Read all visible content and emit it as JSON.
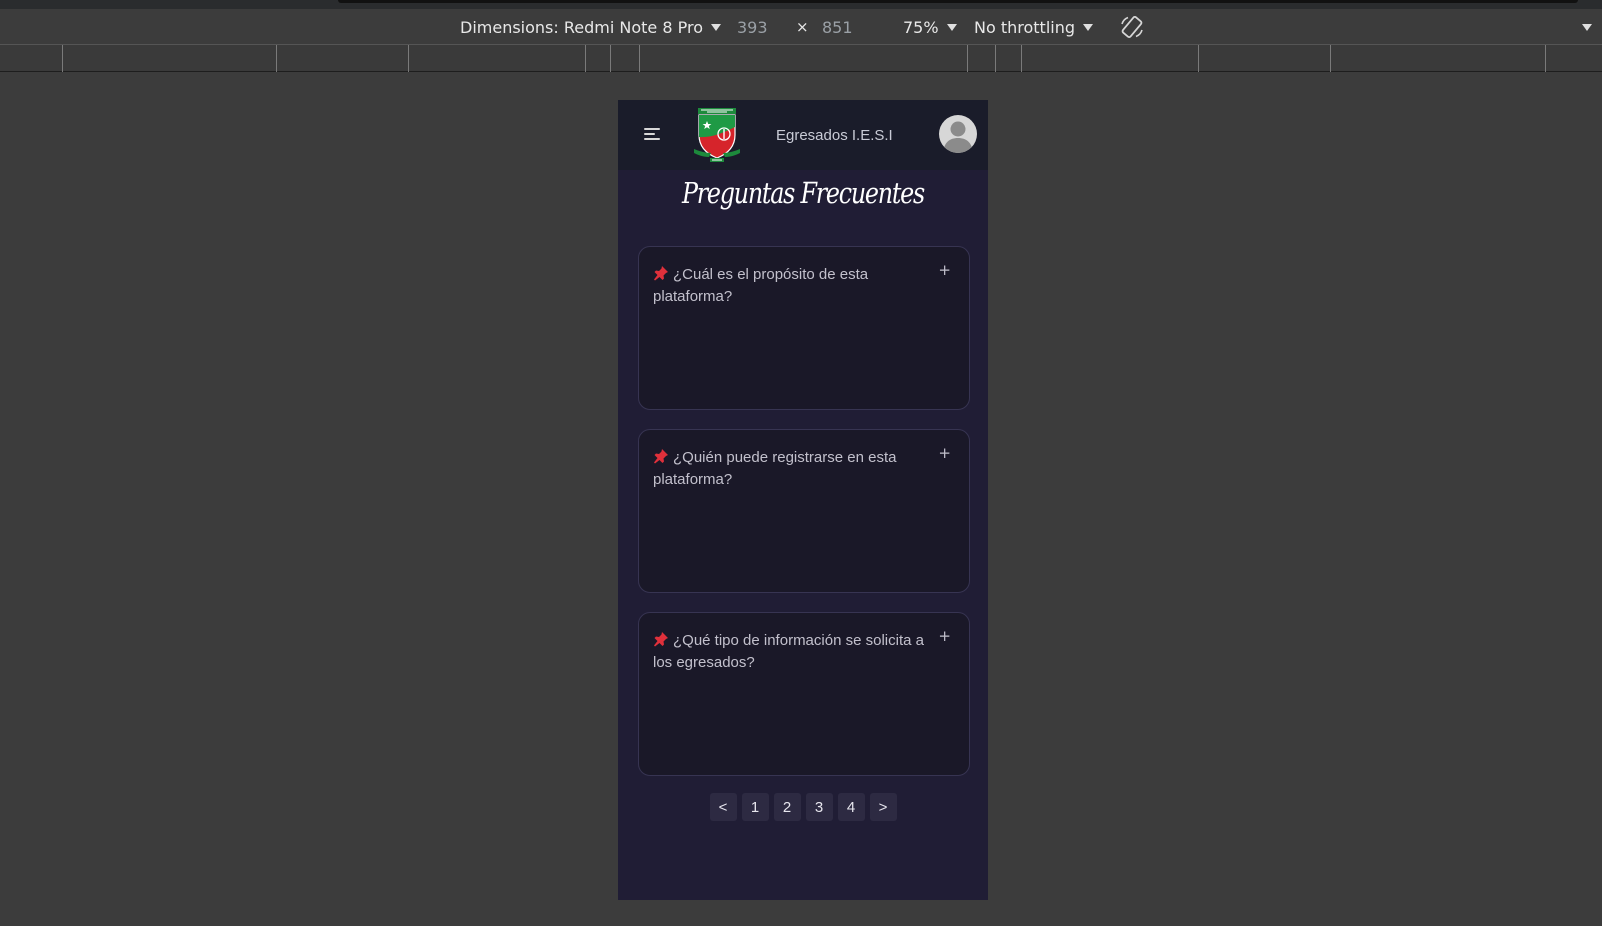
{
  "devtools": {
    "dimensions_label": "Dimensions: Redmi Note 8 Pro",
    "width": "393",
    "times": "×",
    "height": "851",
    "zoom": "75%",
    "throttling": "No throttling",
    "icons": {
      "rotate": "rotate-icon",
      "more": "chevron-down-icon"
    }
  },
  "app": {
    "brand": "Egresados I.E.S.I",
    "icons": {
      "menu": "menu-icon",
      "logo": "school-shield-logo",
      "avatar": "user-avatar-icon",
      "pin": "pushpin-icon",
      "expand": "plus-icon"
    },
    "colors": {
      "header": "#1a1c2a",
      "background": "#201d35",
      "card": "#1a1828",
      "pin": "#e0303b"
    }
  },
  "faq": {
    "title": "Preguntas Frecuentes",
    "items": [
      {
        "question": "¿Cuál es el propósito de esta plataforma?",
        "toggle": "+"
      },
      {
        "question": "¿Quién puede registrarse en esta plataforma?",
        "toggle": "+"
      },
      {
        "question": "¿Qué tipo de información se solicita a los egresados?",
        "toggle": "+"
      }
    ]
  },
  "pagination": {
    "prev": "<",
    "pages": [
      "1",
      "2",
      "3",
      "4"
    ],
    "next": ">"
  }
}
